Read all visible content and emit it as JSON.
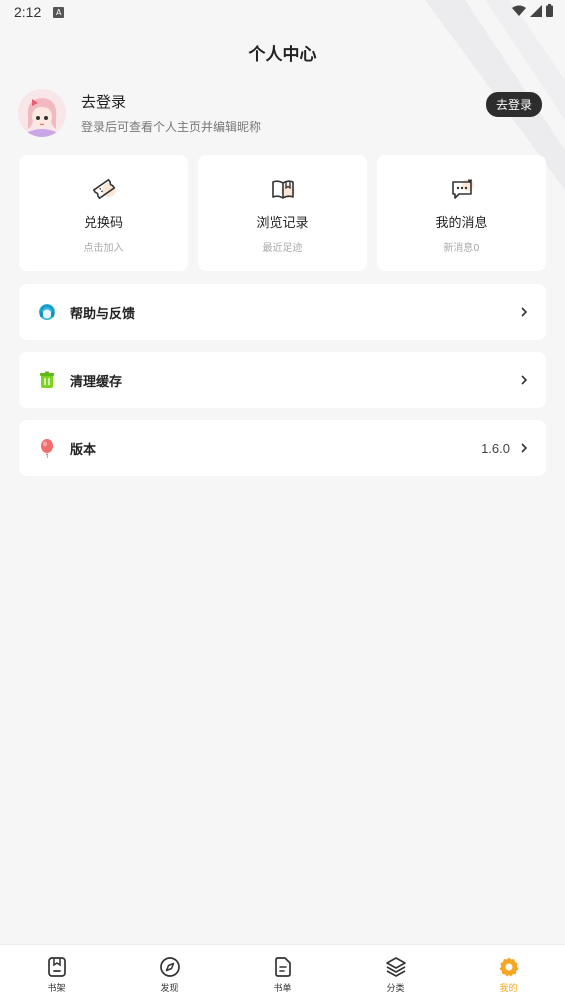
{
  "status_bar": {
    "time": "2:12",
    "notif_icon": "A"
  },
  "header": {
    "title": "个人中心"
  },
  "profile": {
    "name": "去登录",
    "subtitle": "登录后可查看个人主页并编辑昵称",
    "login_button": "去登录"
  },
  "quick_cards": [
    {
      "icon": "ticket-icon",
      "title": "兑换码",
      "subtitle": "点击加入"
    },
    {
      "icon": "book-icon",
      "title": "浏览记录",
      "subtitle": "最近足迹"
    },
    {
      "icon": "message-icon",
      "title": "我的消息",
      "subtitle": "新消息0"
    }
  ],
  "menu": [
    {
      "icon": "headset-icon",
      "label": "帮助与反馈",
      "value": ""
    },
    {
      "icon": "trash-icon",
      "label": "清理缓存",
      "value": ""
    },
    {
      "icon": "balloon-icon",
      "label": "版本",
      "value": "1.6.0"
    }
  ],
  "bottom_nav": [
    {
      "icon": "bookshelf-icon",
      "label": "书架",
      "active": false
    },
    {
      "icon": "compass-icon",
      "label": "发现",
      "active": false
    },
    {
      "icon": "booklist-icon",
      "label": "书单",
      "active": false
    },
    {
      "icon": "layers-icon",
      "label": "分类",
      "active": false
    },
    {
      "icon": "gear-icon",
      "label": "我的",
      "active": true
    }
  ],
  "colors": {
    "accent": "#f5a623",
    "dark_button": "#2d2d2d",
    "background": "#f6f6f7"
  }
}
